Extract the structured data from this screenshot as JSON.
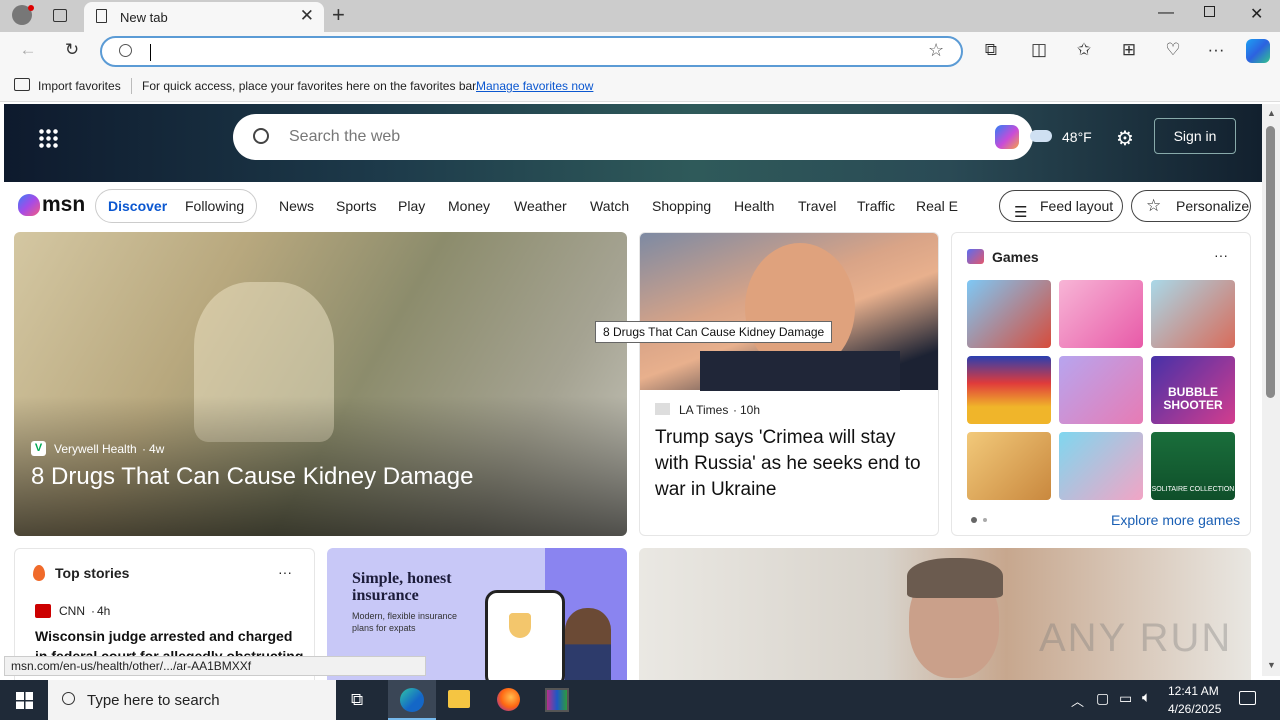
{
  "browser": {
    "tab_title": "New tab",
    "tab_close": "✕",
    "new_tab": "+",
    "address_value": "",
    "favorites": {
      "import_label": "Import favorites",
      "hint": "For quick access, place your favorites here on the favorites bar.",
      "manage_link": "Manage favorites now"
    }
  },
  "msn": {
    "search_placeholder": "Search the web",
    "temperature": "48°F",
    "sign_in": "Sign in",
    "logo": "msn",
    "pills": [
      "Discover",
      "Following"
    ],
    "nav": [
      "News",
      "Sports",
      "Play",
      "Money",
      "Weather",
      "Watch",
      "Shopping",
      "Health",
      "Travel",
      "Traffic",
      "Real E"
    ],
    "feed_layout": "Feed layout",
    "personalize": "Personalize"
  },
  "hero": {
    "source": "Verywell Health",
    "age": "4w",
    "headline": "8 Drugs That Can Cause Kidney Damage"
  },
  "story2": {
    "source": "LA Times",
    "age": "10h",
    "headline": "Trump says 'Crimea will stay with Russia' as he seeks end to war in Ukraine"
  },
  "games": {
    "title": "Games",
    "more": "···",
    "explore": "Explore more games",
    "tiles": [
      "",
      "",
      "",
      "",
      "BUBBLE SHOOTER",
      "",
      "",
      "",
      "SOLITAIRE COLLECTION"
    ]
  },
  "top_stories": {
    "title": "Top stories",
    "more": "···",
    "source": "CNN",
    "age": "4h",
    "headline": "Wisconsin judge arrested and charged in federal court for allegedly obstructing"
  },
  "ad": {
    "title": "Simple, honest insurance",
    "subtitle": "Modern, flexible insurance plans for expats"
  },
  "tooltip": "8 Drugs That Can Cause Kidney Damage",
  "status_url": "msn.com/en-us/health/other/.../ar-AA1BMXXf",
  "watermark": "ANY RUN",
  "taskbar": {
    "search_placeholder": "Type here to search",
    "time": "12:41 AM",
    "date": "4/26/2025"
  },
  "colors": {
    "accent": "#0b57d0",
    "address_border": "#5b9bd5",
    "taskbar": "#1f2a38"
  }
}
